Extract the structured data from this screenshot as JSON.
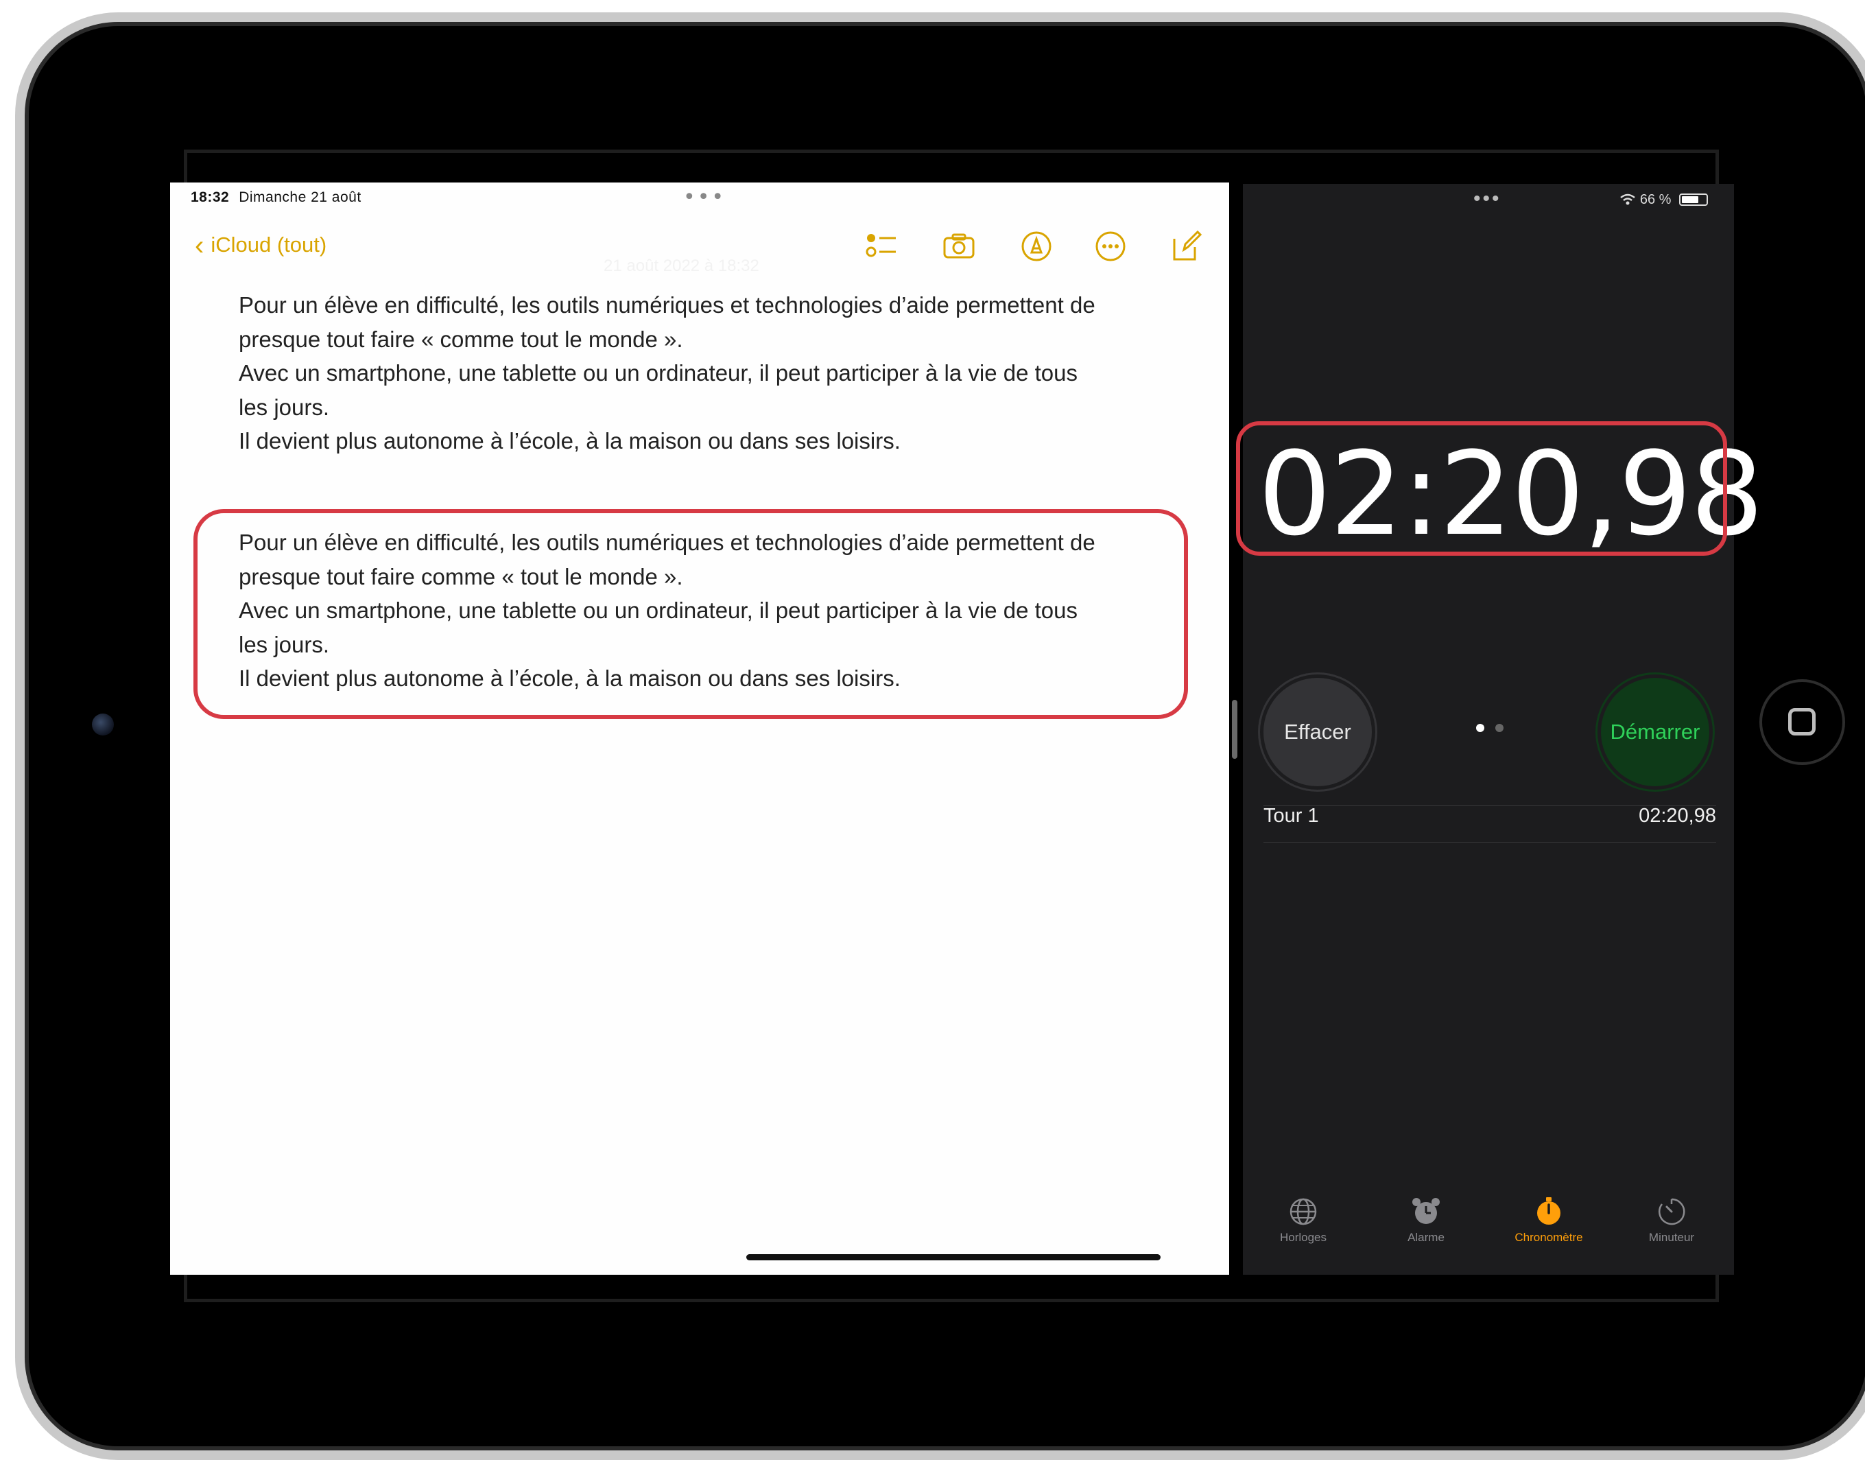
{
  "notes": {
    "status_time": "18:32",
    "status_date": "Dimanche 21 août",
    "back_label": "iCloud (tout)",
    "faint_date": "21 août 2022 à 18:32",
    "block1": [
      "Pour un élève en difficulté, les outils numériques et technologies d’aide permettent de",
      "presque tout faire « comme tout le monde ».",
      "Avec un smartphone, une tablette ou un ordinateur, il peut participer à la vie de tous",
      "les jours.",
      "Il devient plus autonome à l’école, à la maison ou dans ses loisirs."
    ],
    "block2": [
      "Pour un élève en difficulté, les outils numériques et technologies d’aide permettent de",
      "presque tout faire comme « tout le monde ».",
      "Avec un smartphone, une tablette ou un ordinateur, il peut participer à la vie de tous",
      "les jours.",
      "Il devient plus autonome à l’école, à la maison ou dans ses loisirs."
    ],
    "icons": [
      "checklist-icon",
      "camera-icon",
      "markup-pen-icon",
      "more-icon",
      "compose-icon"
    ]
  },
  "clock": {
    "battery": "66 %",
    "timer": "02:20,98",
    "clear_label": "Effacer",
    "start_label": "Démarrer",
    "lap_label": "Tour 1",
    "lap_value": "02:20,98",
    "tabs": [
      {
        "label": "Horloges",
        "icon": "globe-icon"
      },
      {
        "label": "Alarme",
        "icon": "alarm-clock-icon"
      },
      {
        "label": "Chronomètre",
        "icon": "stopwatch-icon"
      },
      {
        "label": "Minuteur",
        "icon": "timer-icon"
      }
    ],
    "active_tab": "Chronomètre",
    "accent": "#ff9f0a",
    "start_color": "#2fd15a"
  },
  "annotation_color": "#d73a44",
  "notes_accent": "#d9a400"
}
